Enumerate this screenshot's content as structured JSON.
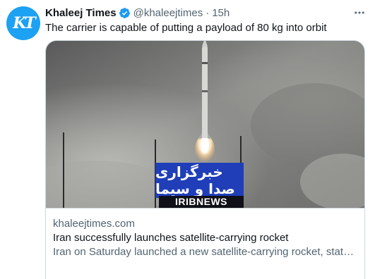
{
  "tweet": {
    "author_name": "Khaleej Times",
    "handle": "@khaleejtimes",
    "separator": "·",
    "time": "15h",
    "text": "The carrier is capable of putting a payload of 80 kg into orbit",
    "avatar_icon": "khaleej-times-logo",
    "verified_icon": "verified-badge-icon",
    "more_icon": "more-options-icon"
  },
  "card": {
    "domain": "khaleejtimes.com",
    "title": "Iran successfully launches satellite-carrying rocket",
    "description": "Iran on Saturday launched a new satellite-carrying rocket, state TV reported, seeking to demonstrate the force's space prowess even as Iran's nuclear talks with world powers have stalled.",
    "description_display": "Iran on Saturday launched a new satellite-carrying rocket, state TV reported, seeking to demonstrate the force's space prowess even as ...",
    "image": {
      "watermark_farsi": "خبرگزاری صدا و سیما",
      "watermark_english": "IRIBNEWS"
    }
  },
  "colors": {
    "accent": "#1d9bf0",
    "text_primary": "#0f1419",
    "text_secondary": "#536471",
    "border": "#cfd9de",
    "watermark_blue": "#1f3eb8"
  }
}
